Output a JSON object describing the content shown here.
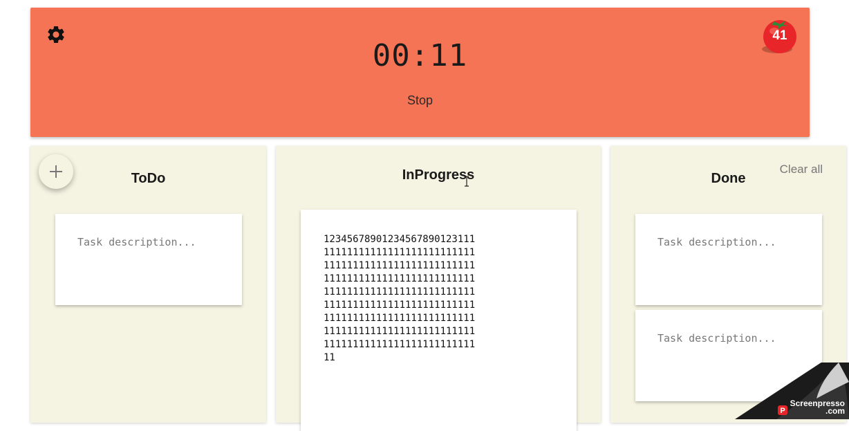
{
  "timer": {
    "time": "00:11",
    "stop_label": "Stop",
    "tomato_count": "41",
    "settings_icon": "gear-icon",
    "tomato_icon": "tomato-icon"
  },
  "columns": {
    "todo": {
      "title": "ToDo",
      "add_icon": "plus-icon",
      "cards": [
        {
          "placeholder": "Task description..."
        }
      ]
    },
    "inprogress": {
      "title": "InProgress",
      "cards": [
        {
          "text": "12345678901234567890123111111111111111111111111111111111111111111111111111111111111111111111111111111111111111111111111111111111111111111111111111111111111111111111111111111111111111111111111111111111111111111111111111111111111111111111"
        }
      ]
    },
    "done": {
      "title": "Done",
      "clear_all_label": "Clear all",
      "cards": [
        {
          "placeholder": "Task description..."
        },
        {
          "placeholder": "Task description..."
        }
      ]
    }
  },
  "watermark": {
    "text_line1": "Screenpresso",
    "text_line2": ".com"
  },
  "colors": {
    "timer_bg": "#f47455",
    "column_bg": "#f5f3e1",
    "tomato_red": "#e8262a"
  }
}
